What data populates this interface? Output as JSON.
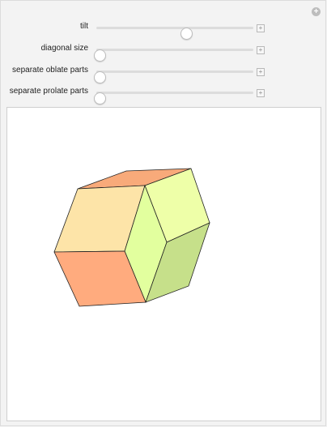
{
  "controls": {
    "sliders": [
      {
        "label": "tilt",
        "value": 0.57
      },
      {
        "label": "diagonal size",
        "value": 0.02
      },
      {
        "label": "separate oblate parts",
        "value": 0.02
      },
      {
        "label": "separate prolate parts",
        "value": 0.02
      }
    ]
  },
  "colors": {
    "top": "#f8aa7a",
    "front_left": "#fde4a8",
    "right_upper": "#eeffa8",
    "right_middle": "#e2ff9e",
    "right_lower": "#c6e08a",
    "bottom_left": "#ffab7e"
  },
  "icons": {
    "corner": "plus-circle-icon",
    "stepper": "plus-icon"
  }
}
